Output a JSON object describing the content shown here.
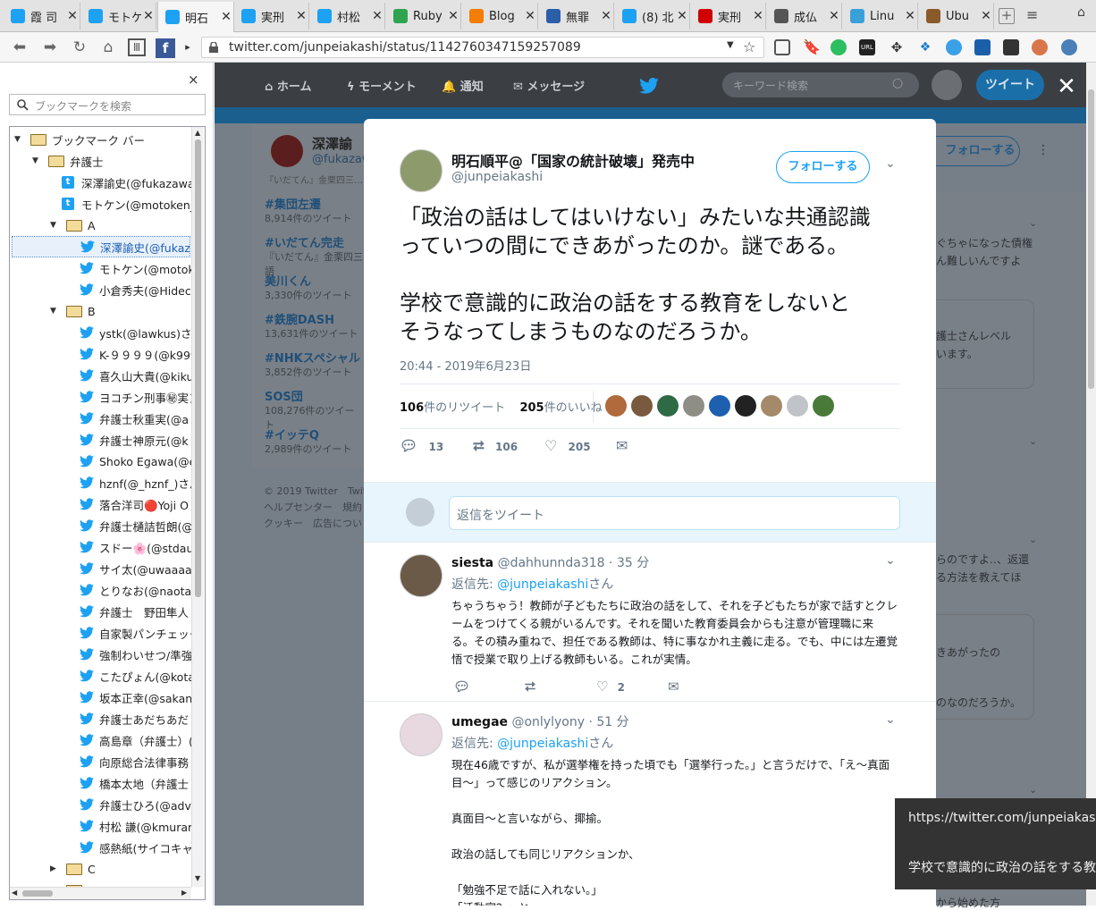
{
  "tabs": [
    {
      "label": "霞 司",
      "color": "#1da1f2"
    },
    {
      "label": "モトケ",
      "color": "#1da1f2"
    },
    {
      "label": "明石",
      "color": "#1da1f2"
    },
    {
      "label": "実刑",
      "color": "#1da1f2"
    },
    {
      "label": "村松",
      "color": "#1da1f2"
    },
    {
      "label": "Ruby",
      "color": "#2ea44f"
    },
    {
      "label": "Blog",
      "color": "#f57d00"
    },
    {
      "label": "無罪",
      "color": "#2a5ea8"
    },
    {
      "label": "(8) 北",
      "color": "#1da1f2"
    },
    {
      "label": "実刑",
      "color": "#d10000"
    },
    {
      "label": "成仏",
      "color": "#555555"
    },
    {
      "label": "Linu",
      "color": "#3aa0d8"
    },
    {
      "label": "Ubu",
      "color": "#8b5a2b"
    }
  ],
  "url": "twitter.com/junpeiakashi/status/1142760347159257089",
  "sidebar": {
    "search_placeholder": "ブックマークを検索",
    "close_label": "×",
    "items": [
      {
        "label": "ブックマーク バー",
        "kind": "folder",
        "level": 0,
        "open": true
      },
      {
        "label": "弁護士",
        "kind": "folder",
        "level": 1,
        "open": true
      },
      {
        "label": "深澤諭史(@fukazawa",
        "kind": "tbox",
        "level": 2
      },
      {
        "label": "モトケン(@motoken_",
        "kind": "tbox",
        "level": 2
      },
      {
        "label": "A",
        "kind": "folder",
        "level": 2,
        "open": true
      },
      {
        "label": "深澤諭史(@fukaz",
        "kind": "bird",
        "level": 3,
        "selected": true
      },
      {
        "label": "モトケン(@motok",
        "kind": "bird",
        "level": 3
      },
      {
        "label": "小倉秀夫(@Hidec",
        "kind": "bird",
        "level": 3
      },
      {
        "label": "B",
        "kind": "folder",
        "level": 2,
        "open": true
      },
      {
        "label": "ystk(@lawkus)さん",
        "kind": "bird",
        "level": 3
      },
      {
        "label": "K-９９９９(@k999",
        "kind": "bird",
        "level": 3
      },
      {
        "label": "喜久山大貴(@kiku",
        "kind": "bird",
        "level": 3
      },
      {
        "label": "ヨコチン刑事㊙実ヌ",
        "kind": "bird",
        "level": 3
      },
      {
        "label": "弁護士秋重実(@a",
        "kind": "bird",
        "level": 3
      },
      {
        "label": "弁護士神原元(@k",
        "kind": "bird",
        "level": 3
      },
      {
        "label": "Shoko Egawa(@e",
        "kind": "bird",
        "level": 3
      },
      {
        "label": "hznf(@_hznf_)さん",
        "kind": "bird",
        "level": 3
      },
      {
        "label": "落合洋司🔴Yoji O",
        "kind": "bird",
        "level": 3
      },
      {
        "label": "弁護士樋詰哲朗(@",
        "kind": "bird",
        "level": 3
      },
      {
        "label": "スドー🌸(@stdau",
        "kind": "bird",
        "level": 3
      },
      {
        "label": "サイ太(@uwaaaa)",
        "kind": "bird",
        "level": 3
      },
      {
        "label": "とりなお(@naotar",
        "kind": "bird",
        "level": 3
      },
      {
        "label": "弁護士　野田隼人",
        "kind": "bird",
        "level": 3
      },
      {
        "label": "自家製パンチェッタ",
        "kind": "bird",
        "level": 3
      },
      {
        "label": "強制わいせつ/準強",
        "kind": "bird",
        "level": 3
      },
      {
        "label": "こたぴょん(@kotac",
        "kind": "bird",
        "level": 3
      },
      {
        "label": "坂本正幸(@sakan",
        "kind": "bird",
        "level": 3
      },
      {
        "label": "弁護士あだちあだ",
        "kind": "bird",
        "level": 3
      },
      {
        "label": "高島章（弁護士）(@",
        "kind": "bird",
        "level": 3
      },
      {
        "label": "向原総合法律事務",
        "kind": "bird",
        "level": 3
      },
      {
        "label": "橋本太地（弁護士",
        "kind": "bird",
        "level": 3
      },
      {
        "label": "弁護士ひろ(@adv",
        "kind": "bird",
        "level": 3
      },
      {
        "label": "村松 謙(@kmurar",
        "kind": "bird",
        "level": 3
      },
      {
        "label": "感熱紙(サイコキャ",
        "kind": "bird",
        "level": 3
      },
      {
        "label": "C",
        "kind": "folder",
        "level": 2,
        "open": false
      },
      {
        "label": "D",
        "kind": "folder",
        "level": 2,
        "open": false
      }
    ]
  },
  "twitter_nav": {
    "home": "ホーム",
    "moments": "モーメント",
    "notifications": "通知",
    "messages": "メッセージ",
    "search_placeholder": "キーワード検索",
    "tweet_button": "ツイート"
  },
  "background": {
    "profile_name": "深澤諭",
    "profile_handle": "@fukazaw",
    "follow_label": "フォローする",
    "trends_top_line": "『いだてん』金栗四三…",
    "trends": [
      {
        "tag": "#集団左遷",
        "count": "8,914件のツイート"
      },
      {
        "tag": "#いだてん完走",
        "count": "『いだてん』金栗四三語"
      },
      {
        "tag": "美川くん",
        "count": "3,330件のツイート"
      },
      {
        "tag": "#鉄腕DASH",
        "count": "13,631件のツイート"
      },
      {
        "tag": "#NHKスペシャル",
        "count": "3,852件のツイート"
      },
      {
        "tag": "SOS団",
        "count": "108,276件のツイート"
      },
      {
        "tag": "#イッテQ",
        "count": "2,989件のツイート"
      }
    ],
    "footer_line1": "© 2019 Twitter　Twit",
    "footer_line2": "ヘルプセンター　規約",
    "footer_line3": "クッキー　広告につい",
    "right_snippets": [
      "ぐちゃになった債権",
      "ん難しいんですよ",
      "護士さんレベル",
      "います。",
      "らのですよ‥、返還",
      "る方法を教えてほ",
      "きあがったの",
      "のなのだろうか。",
      "から始めた方"
    ]
  },
  "tweet": {
    "name": "明石順平@「国家の統計破壊」発売中",
    "handle": "@junpeiakashi",
    "follow_label": "フォローする",
    "text_line1": "「政治の話はしてはいけない」みたいな共通認識",
    "text_line2": "っていつの間にできあがったのか。謎である。",
    "text_line3": "学校で意識的に政治の話をする教育をしないと",
    "text_line4": "そうなってしまうものなのだろうか。",
    "timestamp": "20:44 - 2019年6月23日",
    "retweets_num": "106",
    "retweets_label": "件のリツイート",
    "likes_num": "205",
    "likes_label": "件のいいね",
    "reply_count": "13",
    "retweet_count": "106",
    "like_count": "205",
    "liker_colors": [
      "#b06a3b",
      "#7a5a3e",
      "#2e6b45",
      "#8e8e86",
      "#1e5fb0",
      "#222222",
      "#a48a6a",
      "#c0c4c8",
      "#4a7a3a"
    ],
    "reply_placeholder": "返信をツイート"
  },
  "replies": [
    {
      "name": "siesta",
      "handle": "@dahhunnda318",
      "time": "· 35 分",
      "reply_prefix": "返信先:",
      "reply_to": "@junpeiakashi",
      "reply_suffix": "さん",
      "lines": [
        "ちゃうちゃう！教師が子どもたちに政治の話をして、それを子どもたちが家で話すとクレ",
        "ームをつけてくる親がいるんです。それを聞いた教育委員会からも注意が管理職に来",
        "る。その積み重ねで、担任である教師は、特に事なかれ主義に走る。でも、中には左遷覚",
        "悟で授業で取り上げる教師もいる。これが実情。"
      ],
      "likes": "2"
    },
    {
      "name": "umegae",
      "handle": "@onlylyony",
      "time": "· 51 分",
      "reply_prefix": "返信先:",
      "reply_to": "@junpeiakashi",
      "reply_suffix": "さん",
      "lines": [
        "現在46歳ですが、私が選挙権を持った頃でも「選挙行った。」と言うだけで、「え〜真面",
        "目〜」って感じのリアクション。",
        "",
        "真面目〜と言いながら、揶揄。",
        "",
        "政治の話しても同じリアクションか、",
        "",
        "「勉強不足で話に入れない。」",
        "「活動家？」と"
      ]
    }
  ],
  "tooltip": {
    "line1": "https://twitter.com/junpeiakas",
    "line2": "学校で意識的に政治の話をする教"
  }
}
